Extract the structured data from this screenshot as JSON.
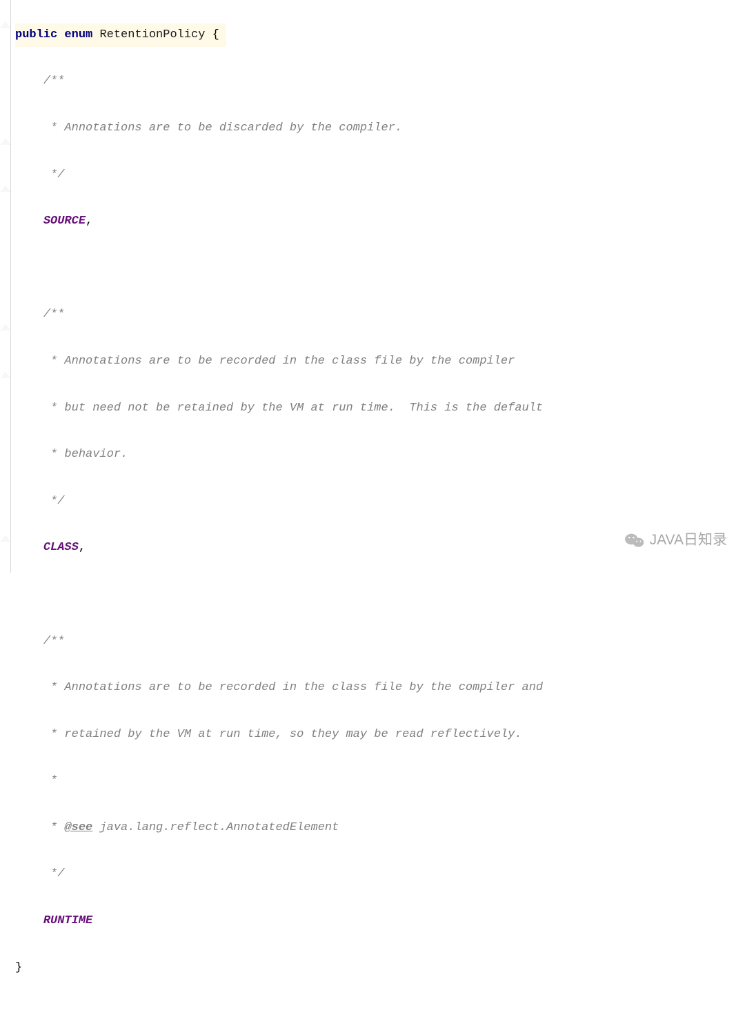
{
  "line1_kw1": "public",
  "line1_kw2": "enum",
  "line1_type": "RetentionPolicy",
  "line1_brace": "{",
  "c1_open": "/**",
  "c1_l1": " * Annotations are to be discarded by the compiler.",
  "c1_close": " */",
  "const1": "SOURCE",
  "comma": ",",
  "c2_open": "/**",
  "c2_l1": " * Annotations are to be recorded in the class file by the compiler",
  "c2_l2": " * but need not be retained by the VM at run time.  This is the default",
  "c2_l3": " * behavior.",
  "c2_close": " */",
  "const2": "CLASS",
  "c3_open": "/**",
  "c3_l1": " * Annotations are to be recorded in the class file by the compiler and",
  "c3_l2": " * retained by the VM at run time, so they may be read reflectively.",
  "c3_l3": " *",
  "c3_l4a": " * ",
  "c3_tag": "@see",
  "c3_l4b": " java.lang.reflect.AnnotatedElement",
  "c3_close": " */",
  "const3": "RUNTIME",
  "close_brace": "}",
  "indent": "    ",
  "watermark": "JAVA日知录"
}
